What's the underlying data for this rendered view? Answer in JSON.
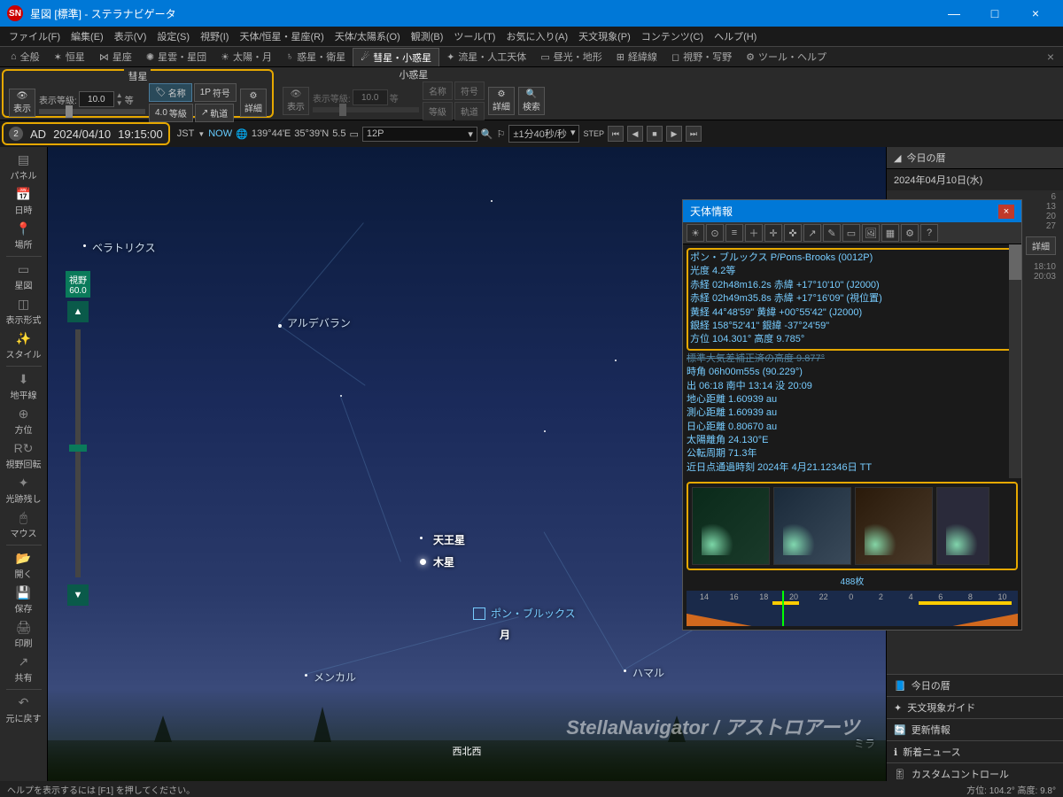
{
  "window": {
    "title": "星図 [標準] - ステラナビゲータ",
    "min": "—",
    "max": "□",
    "close": "×"
  },
  "menu": [
    "ファイル(F)",
    "編集(E)",
    "表示(V)",
    "設定(S)",
    "視野(I)",
    "天体/恒星・星座(R)",
    "天体/太陽系(O)",
    "観測(B)",
    "ツール(T)",
    "お気に入り(A)",
    "天文現象(P)",
    "コンテンツ(C)",
    "ヘルプ(H)"
  ],
  "tabs": [
    {
      "label": "全般"
    },
    {
      "label": "恒星"
    },
    {
      "label": "星座"
    },
    {
      "label": "星雲・星団"
    },
    {
      "label": "太陽・月"
    },
    {
      "label": "惑星・衛星"
    },
    {
      "label": "彗星・小惑星",
      "active": true
    },
    {
      "label": "流星・人工天体"
    },
    {
      "label": "昼光・地形"
    },
    {
      "label": "経緯線"
    },
    {
      "label": "視野・写野"
    },
    {
      "label": "ツール・ヘルプ"
    }
  ],
  "toolbar": {
    "comet": {
      "title": "彗星",
      "show": "表示",
      "mag_label": "表示等級:",
      "mag_value": "10.0",
      "mag_unit": "等",
      "btn_name": "名称",
      "btn_code": "符号",
      "btn_maglvl": "等級",
      "btn_orbit": "軌道",
      "btn_detail": "詳細"
    },
    "asteroid": {
      "title": "小惑星",
      "show": "表示",
      "mag_label": "表示等級:",
      "mag_value": "10.0",
      "mag_unit": "等",
      "btn_name": "名称",
      "btn_code": "符号",
      "btn_maglvl": "等級",
      "btn_orbit": "軌道",
      "btn_detail": "詳細",
      "btn_search": "検索"
    }
  },
  "time": {
    "era": "AD",
    "date": "2024/04/10",
    "clock": "19:15:00",
    "tz": "JST",
    "lon": "139°44'E",
    "lat": "35°39'N",
    "fov": "5.5",
    "object_sel": "12P",
    "step": "±1分40秒/秒"
  },
  "left_tools": [
    "パネル",
    "日時",
    "場所",
    "星図",
    "表示形式",
    "スタイル",
    "地平線",
    "方位",
    "視野回転",
    "光跡残し",
    "マウス",
    "開く",
    "保存",
    "印刷",
    "共有",
    "元に戻す"
  ],
  "sky": {
    "labels": {
      "bellatrix": "ベラトリクス",
      "aldebaran": "アルデバラン",
      "uranus": "天王星",
      "jupiter": "木星",
      "pons": "ポン・ブルックス",
      "moon": "月",
      "menkar": "メンカル",
      "hamal": "ハマル",
      "mira": "ミラ"
    },
    "fov_label": "視野",
    "fov_value": "60.0",
    "compass": "西北西",
    "watermark": "StellaNavigator / アストロアーツ"
  },
  "right": {
    "header": "今日の暦",
    "date": "2024年04月10日(水)",
    "cal_days": [
      "6",
      "13",
      "20",
      "27"
    ],
    "detail": "詳細",
    "sunset_label": "18:10",
    "twilight_label": "20:03",
    "links": [
      "今日の暦",
      "天文現象ガイド",
      "更新情報",
      "新着ニュース",
      "カスタムコントロール"
    ]
  },
  "obj": {
    "title": "天体情報",
    "name": "ポン・ブルックス P/Pons-Brooks (0012P)",
    "mag": "光度   4.2等",
    "ra1": "赤経  02h48m16.2s  赤緯 +17°10'10\"  (J2000)",
    "ra2": "赤経  02h49m35.8s  赤緯 +17°16'09\"  (視位置)",
    "ecl": "黄経  44°48'59\"   黄緯 +00°55'42\"  (J2000)",
    "gal": "銀経 158°52'41\"   銀緯 -37°24'59\"",
    "azalt": "方位 104.301°     高度   9.785°",
    "refr": "標準大気差補正済の高度   9.877°",
    "ha": "時角  06h00m55s (90.229°)",
    "rise": "出 06:18 南中 13:14 没 20:09",
    "geo": "地心距離   1.60939 au",
    "topo": "測心距離   1.60939 au",
    "helio": "日心距離   0.80670 au",
    "elong": "太陽離角 24.130°E",
    "period": "公転周期 71.3年",
    "peri": "近日点通過時刻 2024年 4月21.12346日 TT",
    "thumb_caption": "488枚",
    "tl_hours": [
      "14",
      "16",
      "18",
      "20",
      "22",
      "0",
      "2",
      "4",
      "6",
      "8",
      "10"
    ]
  },
  "status": {
    "help": "ヘルプを表示するには [F1] を押してください。",
    "azalt": "方位: 104.2° 高度: 9.8°"
  }
}
